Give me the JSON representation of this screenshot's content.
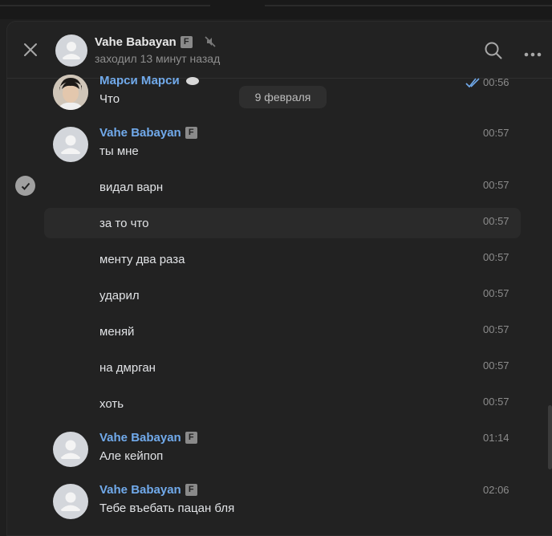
{
  "header": {
    "name": "Vahe Babayan",
    "badge": "F",
    "status": "заходил 13 минут назад"
  },
  "date_separator": "9 февраля",
  "messages": [
    {
      "author": "Марси Марси",
      "text": "Что",
      "time": "00:56"
    },
    {
      "author": "Vahe Babayan",
      "badge": "F",
      "text": "ты мне",
      "time": "00:57"
    },
    {
      "text": "видал варн",
      "time": "00:57"
    },
    {
      "text": "за то что",
      "time": "00:57"
    },
    {
      "text": "менту два раза",
      "time": "00:57"
    },
    {
      "text": "ударил",
      "time": "00:57"
    },
    {
      "text": "меняй",
      "time": "00:57"
    },
    {
      "text": "на дмрган",
      "time": "00:57"
    },
    {
      "text": "хоть",
      "time": "00:57"
    },
    {
      "author": "Vahe Babayan",
      "badge": "F",
      "text": "Але кейпоп",
      "time": "01:14"
    },
    {
      "author": "Vahe Babayan",
      "badge": "F",
      "text": "Тебе въебать пацан бля",
      "time": "02:06"
    }
  ],
  "colors": {
    "background": "#222222",
    "author": "#71aaeb",
    "text": "#e1e3e6",
    "time": "#8c8c8c",
    "read_check": "#71aaeb"
  },
  "icons": [
    "close-icon",
    "mute-icon",
    "search-icon",
    "more-icon",
    "read-check-icon",
    "select-check-icon"
  ]
}
